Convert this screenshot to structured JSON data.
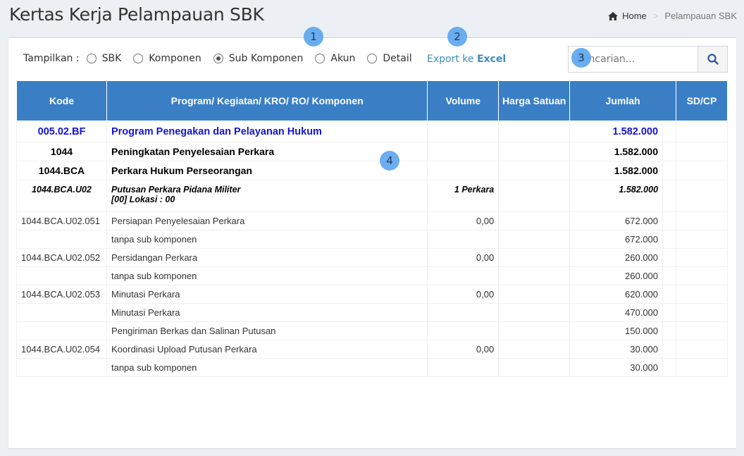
{
  "page": {
    "title": "Kertas Kerja Pelampauan SBK"
  },
  "breadcrumb": {
    "home": "Home",
    "separator": ">",
    "current": "Pelampauan SBK"
  },
  "toolbar": {
    "label": "Tampilkan :",
    "options": [
      {
        "label": "SBK",
        "checked": false
      },
      {
        "label": "Komponen",
        "checked": false
      },
      {
        "label": "Sub Komponen",
        "checked": true
      },
      {
        "label": "Akun",
        "checked": false
      },
      {
        "label": "Detail",
        "checked": false
      }
    ],
    "export_prefix": "Export ke ",
    "export_bold": "Excel"
  },
  "search": {
    "placeholder": "Pencarian..."
  },
  "table": {
    "headers": [
      "Kode",
      "Program/ Kegiatan/ KRO/ RO/ Komponen",
      "Volume",
      "Harga Satuan",
      "Jumlah",
      "SD/CP"
    ],
    "rows": [
      {
        "level": 0,
        "code": "005.02.BF",
        "name": "Program Penegakan dan Pelayanan Hukum",
        "volume": "",
        "harga": "",
        "jumlah": "1.582.000",
        "sdcp": ""
      },
      {
        "level": 1,
        "code": "1044",
        "name": "Peningkatan Penyelesaian Perkara",
        "volume": "",
        "harga": "",
        "jumlah": "1.582.000",
        "sdcp": ""
      },
      {
        "level": 1,
        "code": "1044.BCA",
        "name": "Perkara Hukum Perseorangan",
        "volume": "",
        "harga": "",
        "jumlah": "1.582.000",
        "sdcp": ""
      },
      {
        "level": 3,
        "code": "1044.BCA.U02",
        "name": "Putusan Perkara Pidana Militer",
        "name2": "[00] Lokasi : 00",
        "volume": "1 Perkara",
        "harga": "",
        "jumlah": "1.582.000",
        "sdcp": ""
      },
      {
        "level": 4,
        "code": "1044.BCA.U02.051",
        "name": "Persiapan Penyelesaian Perkara",
        "volume": "0,00",
        "harga": "",
        "jumlah": "672.000",
        "sdcp": ""
      },
      {
        "level": 4,
        "code": "",
        "name": "tanpa sub komponen",
        "volume": "",
        "harga": "",
        "jumlah": "672.000",
        "sdcp": ""
      },
      {
        "level": 4,
        "code": "1044.BCA.U02.052",
        "name": "Persidangan Perkara",
        "volume": "0,00",
        "harga": "",
        "jumlah": "260.000",
        "sdcp": ""
      },
      {
        "level": 4,
        "code": "",
        "name": "tanpa sub komponen",
        "volume": "",
        "harga": "",
        "jumlah": "260.000",
        "sdcp": ""
      },
      {
        "level": 4,
        "code": "1044.BCA.U02.053",
        "name": "Minutasi Perkara",
        "volume": "0,00",
        "harga": "",
        "jumlah": "620.000",
        "sdcp": ""
      },
      {
        "level": 4,
        "code": "",
        "name": "Minutasi Perkara",
        "volume": "",
        "harga": "",
        "jumlah": "470.000",
        "sdcp": ""
      },
      {
        "level": 4,
        "code": "",
        "name": "Pengiriman Berkas dan Salinan Putusan",
        "volume": "",
        "harga": "",
        "jumlah": "150.000",
        "sdcp": ""
      },
      {
        "level": 4,
        "code": "1044.BCA.U02.054",
        "name": "Koordinasi Upload Putusan Perkara",
        "volume": "0,00",
        "harga": "",
        "jumlah": "30.000",
        "sdcp": ""
      },
      {
        "level": 4,
        "code": "",
        "name": "tanpa sub komponen",
        "volume": "",
        "harga": "",
        "jumlah": "30.000",
        "sdcp": ""
      }
    ]
  },
  "annotations": [
    "1",
    "2",
    "3",
    "4"
  ],
  "colors": {
    "header_bg": "#3a7fc6",
    "program_text": "#1414d2",
    "link": "#3c8dbc",
    "badge": "#5ea7f0"
  }
}
